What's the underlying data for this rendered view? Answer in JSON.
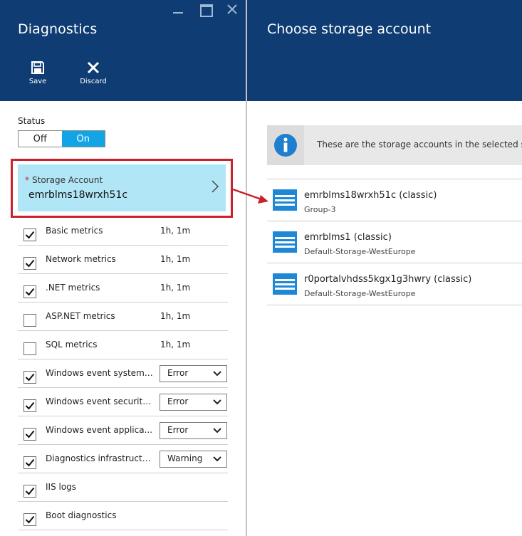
{
  "left_blade": {
    "title": "Diagnostics",
    "commands": [
      {
        "label": "Save",
        "icon": "save-icon"
      },
      {
        "label": "Discard",
        "icon": "close-icon"
      }
    ],
    "status": {
      "label": "Status",
      "off_label": "Off",
      "on_label": "On",
      "selected": "On"
    },
    "storage_account": {
      "required_mark": "*",
      "label": "Storage Account",
      "value": "emrblms18wrxh51c"
    },
    "metrics": [
      {
        "name": "Basic metrics",
        "checked": true,
        "period": "1h, 1m"
      },
      {
        "name": "Network metrics",
        "checked": true,
        "period": "1h, 1m"
      },
      {
        "name": ".NET metrics",
        "checked": true,
        "period": "1h, 1m"
      },
      {
        "name": "ASP.NET metrics",
        "checked": false,
        "period": "1h, 1m"
      },
      {
        "name": "SQL metrics",
        "checked": false,
        "period": "1h, 1m"
      },
      {
        "name": "Windows event system ...",
        "checked": true,
        "level": "Error"
      },
      {
        "name": "Windows event security...",
        "checked": true,
        "level": "Error"
      },
      {
        "name": "Windows event applica...",
        "checked": true,
        "level": "Error"
      },
      {
        "name": "Diagnostics infrastructu...",
        "checked": true,
        "level": "Warning"
      },
      {
        "name": "IIS logs",
        "checked": true
      },
      {
        "name": "Boot diagnostics",
        "checked": true
      }
    ]
  },
  "right_blade": {
    "title": "Choose storage account",
    "info_text": "These are the storage accounts in the selected su",
    "accounts": [
      {
        "name": "emrblms18wrxh51c (classic)",
        "group": "Group-3"
      },
      {
        "name": "emrblms1 (classic)",
        "group": "Default-Storage-WestEurope"
      },
      {
        "name": "r0portalvhdss5kgx1g3hwry (classic)",
        "group": "Default-Storage-WestEurope"
      }
    ]
  },
  "colors": {
    "header_bg": "#0f3c73",
    "toggle_on": "#12a5e6",
    "selected_row_bg": "#b1e6f7",
    "highlight_red": "#c8222c",
    "storage_icon_blue": "#1e88d6"
  }
}
